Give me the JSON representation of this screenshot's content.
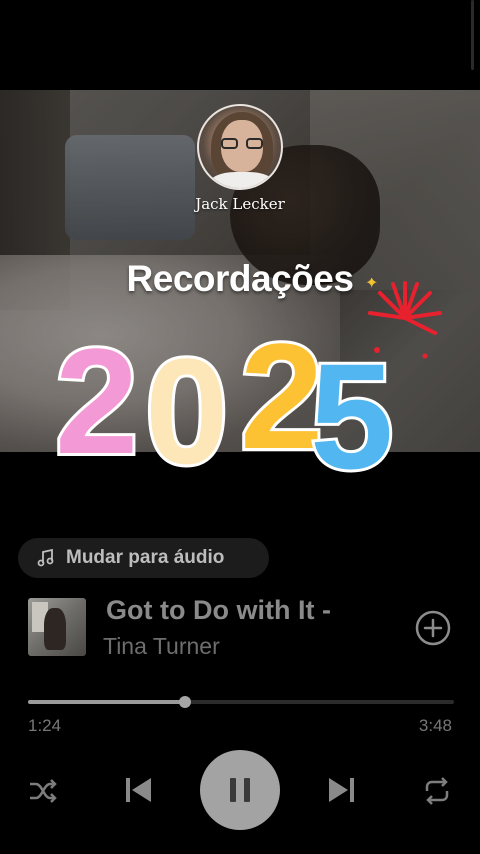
{
  "profile": {
    "name": "Jack Lecker"
  },
  "story": {
    "headline": "Recordações",
    "sticker_year": "2025"
  },
  "player": {
    "switch_label": "Mudar para áudio",
    "track": {
      "title": "Got to Do with It -",
      "artist": "Tina Turner"
    },
    "progress": {
      "elapsed": "1:24",
      "total": "3:48",
      "fraction": 0.368
    }
  },
  "colors": {
    "background": "#000000",
    "digit_2a": "#f39ad6",
    "digit_0": "#fde7b9",
    "digit_2b": "#fcc233",
    "digit_5": "#52b6f0",
    "firework": "#e8212f"
  },
  "icons": [
    "music-note-icon",
    "plus-circle-icon",
    "shuffle-icon",
    "previous-icon",
    "pause-icon",
    "next-icon",
    "repeat-icon",
    "firework-icon"
  ]
}
